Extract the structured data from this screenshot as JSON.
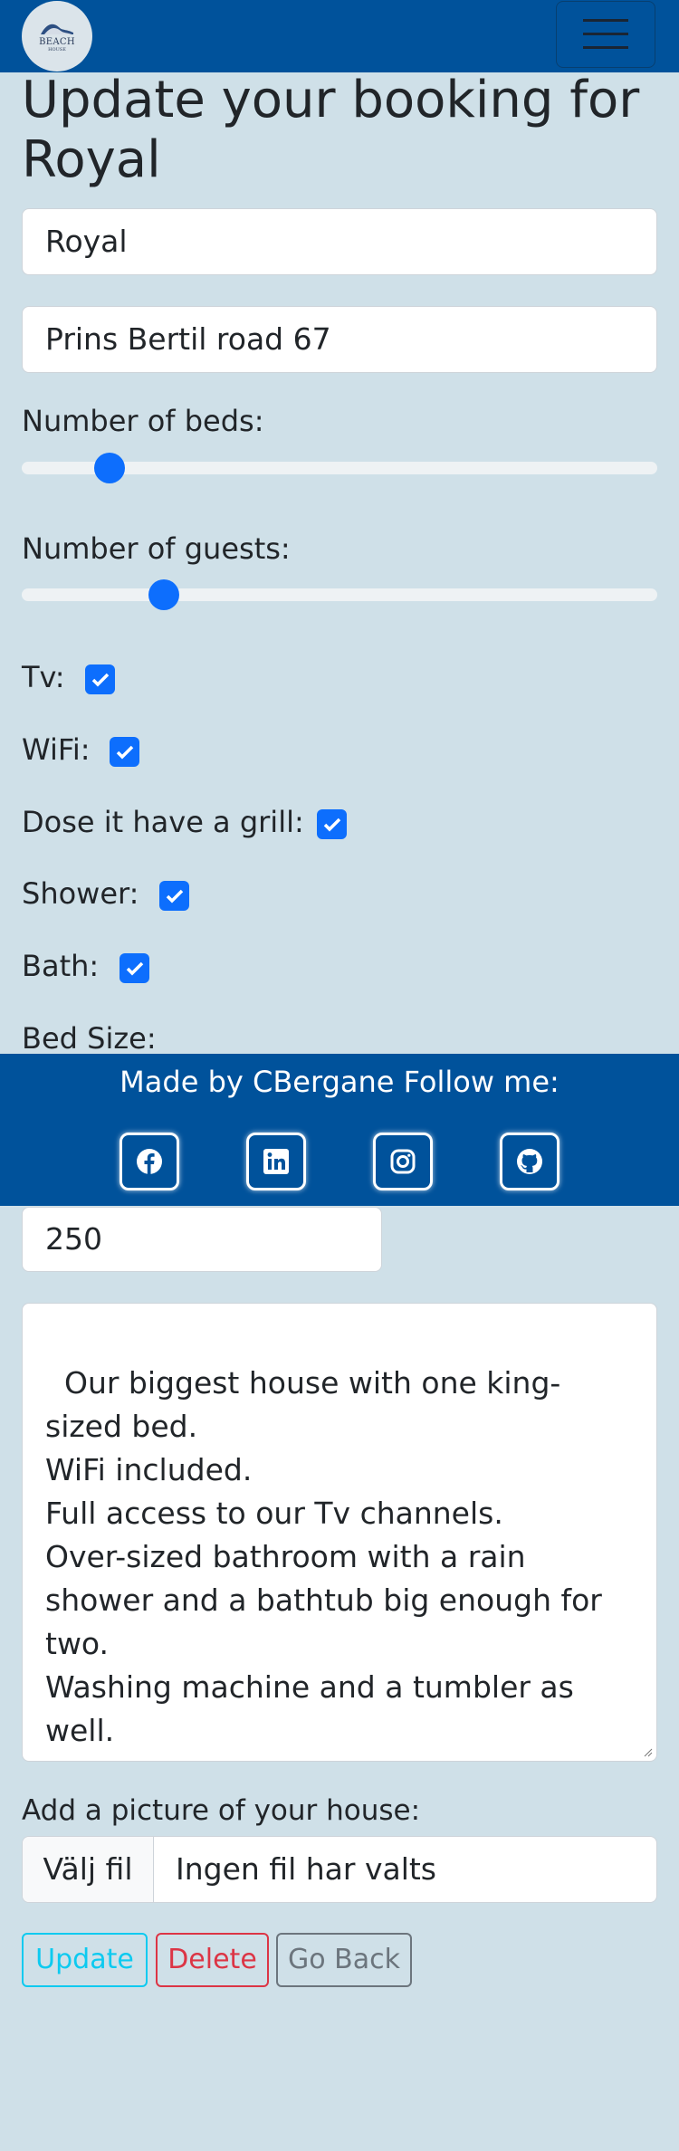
{
  "navbar": {
    "logo_text": "BEACH",
    "logo_subtext": "HOUSE",
    "brand_color": "#00529b"
  },
  "page": {
    "title": "Update your booking for Royal"
  },
  "form": {
    "name_value": "Royal",
    "address_value": "Prins Bertil road 67",
    "beds_label": "Number of beds:",
    "beds_level": 0.12,
    "guests_label": "Number of guests:",
    "guests_level": 0.21,
    "checkboxes": [
      {
        "label": "Tv:",
        "checked": true
      },
      {
        "label": "WiFi:",
        "checked": true
      },
      {
        "label": "Dose it have a grill:",
        "checked": true
      },
      {
        "label": "Shower:",
        "checked": true
      },
      {
        "label": "Bath:",
        "checked": true
      }
    ],
    "bed_size_label": "Bed Size:",
    "price_value": "250",
    "description_value": "Our biggest house with one king-sized bed.\nWiFi included.\nFull access to our Tv channels.\nOver-sized bathroom with a rain shower and a bathtub big enough for two.\nWashing machine and a tumbler as well.\nOur most luxurious furniture, a deck with a grill, and a view over the ocean.",
    "picture_label": "Add a picture of your house:",
    "file_button_label": "Välj fil",
    "file_status": "Ingen fil har valts",
    "update_label": "Update",
    "delete_label": "Delete",
    "back_label": "Go Back"
  },
  "footer": {
    "text": "Made by CBergane Follow me:",
    "social_icons": [
      "facebook-icon",
      "linkedin-icon",
      "instagram-icon",
      "github-icon"
    ]
  },
  "colors": {
    "page_background": "#cfe0e8",
    "accent": "#0d6efd",
    "update": "#0dcaf0",
    "delete": "#dc3545",
    "back": "#6c757d"
  }
}
